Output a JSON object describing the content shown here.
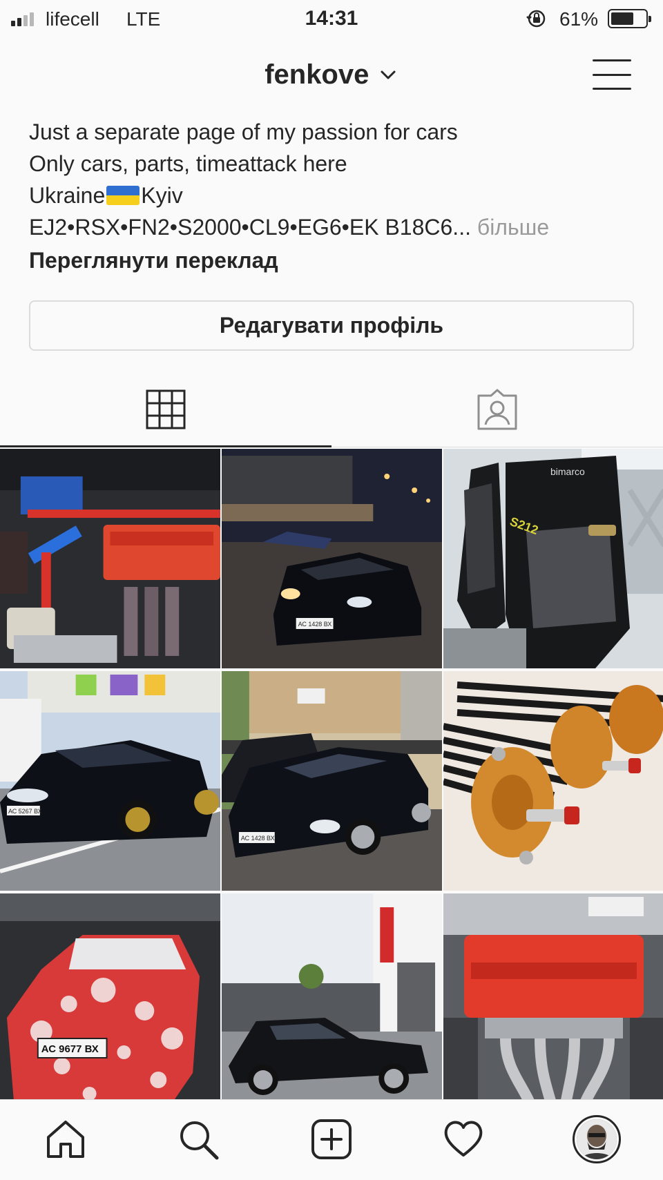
{
  "status_bar": {
    "carrier": "lifecell",
    "network": "LTE",
    "time": "14:31",
    "battery_percent": "61%",
    "battery_level": 0.61
  },
  "header": {
    "username": "fenkove"
  },
  "bio": {
    "line1": "Just a separate page of my passion for cars",
    "line2": "Only cars, parts, timeattack here",
    "line3_before_flag": "Ukraine",
    "line3_after_flag": "Kyiv",
    "line4": "EJ2•RSX•FN2•S2000•CL9•EG6•EK B18C6...",
    "more_label": "більше",
    "translate_label": "Переглянути переклад"
  },
  "edit_profile_label": "Редагувати профіль",
  "tabs": [
    "grid-icon",
    "tagged-icon"
  ],
  "posts": [
    {
      "name": "engine-bay",
      "plate": ""
    },
    {
      "name": "civic-night",
      "plate": "АС 1428 ВХ"
    },
    {
      "name": "bucket-seats",
      "seat_brand": "bimarco",
      "seat_label": "S212"
    },
    {
      "name": "civic-type-r",
      "plate": "АС 5267 ВХ"
    },
    {
      "name": "civic-street",
      "plate": "АС 1428 ВХ"
    },
    {
      "name": "coilovers",
      "plate": ""
    },
    {
      "name": "s2000-foam",
      "plate": "АС 9677 ВХ"
    },
    {
      "name": "civic-hatch",
      "plate": ""
    },
    {
      "name": "engine-valve-cover",
      "plate": ""
    }
  ],
  "bottom_nav": [
    "home-icon",
    "search-icon",
    "new-post-icon",
    "activity-icon",
    "profile-avatar"
  ],
  "colors": {
    "text": "#262626",
    "border": "#dbdbdb",
    "secondary": "#9a9a9a",
    "flag_blue": "#2f6fd0",
    "flag_yellow": "#f6cf1c"
  }
}
